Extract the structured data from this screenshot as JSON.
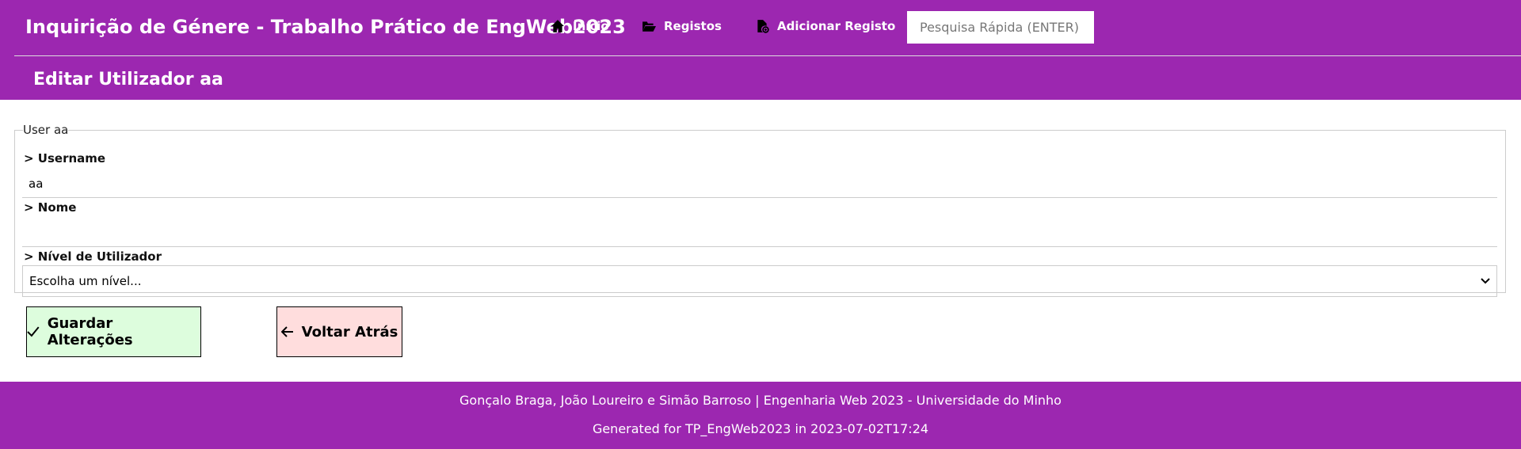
{
  "header": {
    "title": "Inquirição de Génere - Trabalho Prático de EngWeb2023",
    "nav": [
      {
        "label": "Início",
        "icon": "home-icon"
      },
      {
        "label": "Registos",
        "icon": "folder-open-icon"
      },
      {
        "label": "Adicionar Registo",
        "icon": "file-add-icon"
      }
    ],
    "search_placeholder": "Pesquisa Rápida (ENTER)"
  },
  "page": {
    "title": "Editar Utilizador aa"
  },
  "form": {
    "legend": "User aa",
    "username_label": "> Username",
    "username_value": "aa",
    "nome_label": "> Nome",
    "nome_value": "",
    "nivel_label": "> Nível de Utilizador",
    "nivel_selected": "Escolha um nível..."
  },
  "buttons": {
    "save": "Guardar Alterações",
    "back": "Voltar Atrás"
  },
  "footer": {
    "line1": "Gonçalo Braga, João Loureiro e Simão Barroso | Engenharia Web 2023 - Universidade do Minho",
    "line2": "Generated for TP_EngWeb2023 in 2023-07-02T17:24"
  },
  "colors": {
    "brand": "#9c27b0",
    "save_bg": "#ddfddd",
    "back_bg": "#ffdddd"
  }
}
